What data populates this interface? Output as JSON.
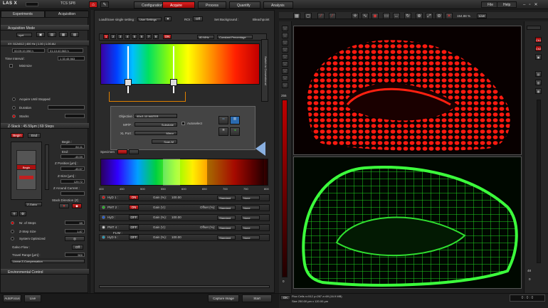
{
  "titlebar": {
    "app": "LAS X",
    "instrument": "TCS SP8",
    "tabs": [
      "Configuration",
      "Acquire",
      "Process",
      "Quantify",
      "Analysis"
    ],
    "active_tab": "Acquire",
    "menu": [
      "File",
      "Help"
    ],
    "accent": "#d01818"
  },
  "left": {
    "tabs": [
      "Experiments",
      "Acquisition"
    ],
    "acq_mode": {
      "title": "Acquisition Mode",
      "mode": "xyzt",
      "info1": "XY: 512x512 | 400 Hz | 1.00 | 1.00 AU",
      "info2": "00:09:19.398 h",
      "info3": "01:10:40.563 h",
      "time_interval_label": "Time Interval :",
      "time_interval": "1  33  45  563",
      "minimize": "Minimize",
      "until_stopped": "Acquire Until Stopped",
      "duration": "Duration",
      "stacks": "Stacks"
    },
    "zstack": {
      "title": "Z-Stack : 45.59µm | 69 Steps",
      "begin_btn": "Begin",
      "end_btn": "End",
      "begin_label": "Begin :",
      "begin_val": "84.11",
      "end_label": "End :",
      "end_val": "-45.59",
      "zpos_label": "Z Position [µm] :",
      "zpos_val": "-45.57",
      "zsize_label": "Z-Size [µm] :",
      "zsize_val": "129.72",
      "zaround_label": "Z Around Current :",
      "stackdir_label": "Stack Direction (Z) :",
      "galvo_select": "Z-Galvo",
      "slider_label": "Begin",
      "nsteps_label": "Nr. of Steps",
      "nsteps": "69",
      "stepsize_label": "Z-Step Size",
      "stepsize": "1.87",
      "optimized": "System Optimized",
      "galvoflow_label": "Galvo Flow :",
      "galvoflow": "Off",
      "travel_label": "Travel Range [µm] :",
      "travel": "500",
      "linearz": "Linear Z-Compensation"
    },
    "env": "Environmental Control"
  },
  "center": {
    "loadsave": "Load/Save single setting :",
    "usersettings": "User Settings",
    "roi_label": "ROI :",
    "set_bg": "Set Background :",
    "bleach": "Bleachpoint",
    "seq": [
      "1",
      "2",
      "3",
      "4",
      "5",
      "6",
      "7",
      "8"
    ],
    "on": "ON",
    "freq": "80 MHz",
    "mode": "Constant Percentage",
    "switch": "Switch to Conventional",
    "objective_label": "Objective :",
    "objective": "40x/1.10 WATER",
    "mpp_label": "MP/P :",
    "mpp": "Substrate",
    "xlport_label": "XL Port :",
    "xlport": "Mirror",
    "scanm": "Scan-M",
    "autoselect": "Autoselect",
    "specimen": "Specimen",
    "spectrum_ticks": [
      "400",
      "450",
      "500",
      "550",
      "600",
      "650",
      "700",
      "750",
      "800"
    ],
    "detectors": [
      {
        "name": "HyD 1 :",
        "on": "ON",
        "gain_label": "Gain (%):",
        "gain": "100.00",
        "preset": "Standard",
        "lut": "None",
        "color": "#e01010"
      },
      {
        "name": "PMT 2 :",
        "on": "ON",
        "gain_label": "Gain (V):",
        "gain": "",
        "offset_label": "Offset (%):",
        "preset": "Standard",
        "lut": "None",
        "color": "#20c020"
      },
      {
        "name": "HyD :",
        "on": "OFF",
        "gain_label": "Gain (%):",
        "gain": "100.00",
        "preset": "Standard",
        "lut": "None",
        "color": "#2060e0"
      },
      {
        "name": "PMT 4 :",
        "on": "OFF",
        "gain_label": "Gain (V):",
        "offset_label": "Offset (%):",
        "extra": "FLIM :",
        "preset": "Standard",
        "lut": "None",
        "color": "#d0d0d0"
      },
      {
        "name": "HyD 5 :",
        "on": "OFF",
        "gain_label": "Gain (%):",
        "gain": "100.00",
        "preset": "Standard",
        "lut": "None",
        "color": "#20a0c0"
      }
    ]
  },
  "viewer": {
    "zoom": "154.88 %",
    "live": "Live",
    "lut_top": "255",
    "lut_bottom": "0",
    "lut_top2": "48",
    "lut_bottom2": "0",
    "info1": "Fluo Cells x=512 y=267 z=69 (16.9 MB)",
    "info2": "Size 250.00 µm x 120.00 µm",
    "side": [
      "Ch1",
      "Ch2"
    ]
  },
  "bottom": {
    "autofocus": "AutoFocus",
    "live": "Live",
    "capture": "Capture Image",
    "start": "Start",
    "counter": "0 : 0 : 0"
  }
}
